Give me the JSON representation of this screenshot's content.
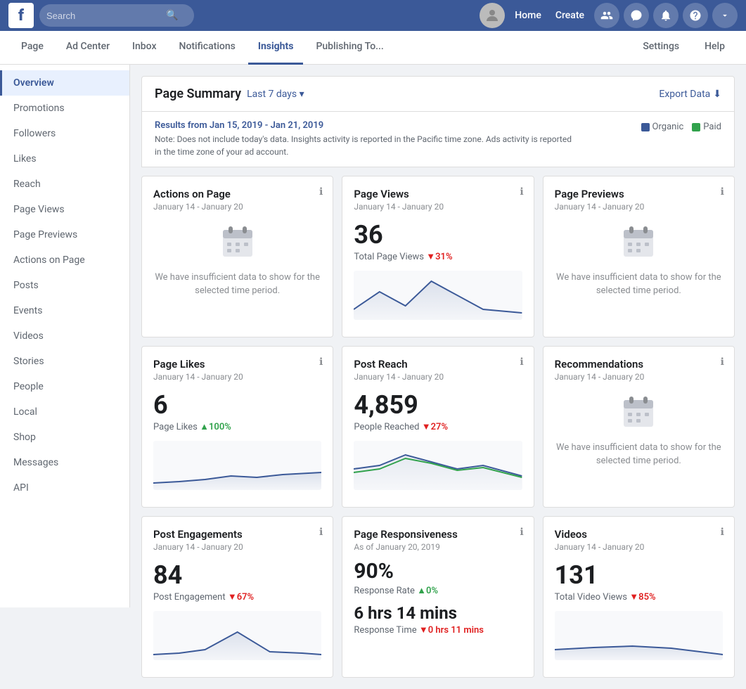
{
  "topNav": {
    "logo": "f",
    "searchPlaceholder": "Search",
    "navLinks": [
      "Home",
      "Create"
    ],
    "icons": [
      "people-icon",
      "messenger-icon",
      "bell-icon",
      "help-icon",
      "dropdown-icon"
    ]
  },
  "secondaryNav": {
    "items": [
      "Page",
      "Ad Center",
      "Inbox",
      "Notifications",
      "Insights",
      "Publishing To..."
    ],
    "activeItem": "Insights",
    "rightItems": [
      "Settings",
      "Help"
    ]
  },
  "sidebar": {
    "items": [
      {
        "label": "Overview",
        "active": true
      },
      {
        "label": "Promotions"
      },
      {
        "label": "Followers"
      },
      {
        "label": "Likes"
      },
      {
        "label": "Reach"
      },
      {
        "label": "Page Views"
      },
      {
        "label": "Page Previews"
      },
      {
        "label": "Actions on Page"
      },
      {
        "label": "Posts"
      },
      {
        "label": "Events"
      },
      {
        "label": "Videos"
      },
      {
        "label": "Stories"
      },
      {
        "label": "People"
      },
      {
        "label": "Local"
      },
      {
        "label": "Shop"
      },
      {
        "label": "Messages"
      },
      {
        "label": "API"
      }
    ]
  },
  "pageSummary": {
    "title": "Page Summary",
    "dateFilter": "Last 7 days ▾",
    "exportLabel": "Export Data",
    "infoBanner": {
      "dateRange": "Results from Jan 15, 2019 - Jan 21, 2019",
      "note": "Note: Does not include today's data. Insights activity is reported in the Pacific time zone. Ads activity is reported in the time zone of your ad account.",
      "legend": [
        {
          "label": "Organic",
          "color": "#3b5998"
        },
        {
          "label": "Paid",
          "color": "#31a24c"
        }
      ]
    }
  },
  "cards": [
    {
      "id": "actions-on-page",
      "title": "Actions on Page",
      "date": "January 14 - January 20",
      "insufficient": true,
      "insufficientMsg": "We have insufficient data to show for the selected time period."
    },
    {
      "id": "page-views",
      "title": "Page Views",
      "date": "January 14 - January 20",
      "value": "36",
      "subLabel": "Total Page Views",
      "changeDir": "down",
      "changePct": "31%",
      "hasChart": true,
      "chartType": "line-blue"
    },
    {
      "id": "page-previews",
      "title": "Page Previews",
      "date": "January 14 - January 20",
      "insufficient": true,
      "insufficientMsg": "We have insufficient data to show for the selected time period."
    },
    {
      "id": "page-likes",
      "title": "Page Likes",
      "date": "January 14 - January 20",
      "value": "6",
      "subLabel": "Page Likes",
      "changeDir": "up",
      "changePct": "100%",
      "hasChart": true,
      "chartType": "line-blue-low"
    },
    {
      "id": "post-reach",
      "title": "Post Reach",
      "date": "January 14 - January 20",
      "value": "4,859",
      "subLabel": "People Reached",
      "changeDir": "down",
      "changePct": "27%",
      "hasChart": true,
      "chartType": "line-two"
    },
    {
      "id": "recommendations",
      "title": "Recommendations",
      "date": "January 14 - January 20",
      "insufficient": true,
      "insufficientMsg": "We have insufficient data to show for the selected time period."
    },
    {
      "id": "post-engagements",
      "title": "Post Engagements",
      "date": "January 14 - January 20",
      "value": "84",
      "subLabel": "Post Engagement",
      "changeDir": "down",
      "changePct": "67%",
      "hasChart": true,
      "chartType": "line-blue-hump"
    },
    {
      "id": "page-responsiveness",
      "title": "Page Responsiveness",
      "date": "As of January 20, 2019",
      "value": "90%",
      "subLabel": "Response Rate",
      "changeDir": "up",
      "changePct": "0%",
      "secondValue": "6 hrs 14 mins",
      "secondSubLabel": "Response Time",
      "secondChangeDir": "down",
      "secondChangePct": "0 hrs 11 mins"
    },
    {
      "id": "videos",
      "title": "Videos",
      "date": "January 14 - January 20",
      "value": "131",
      "subLabel": "Total Video Views",
      "changeDir": "down",
      "changePct": "85%",
      "hasChart": true,
      "chartType": "line-blue-flat"
    }
  ]
}
